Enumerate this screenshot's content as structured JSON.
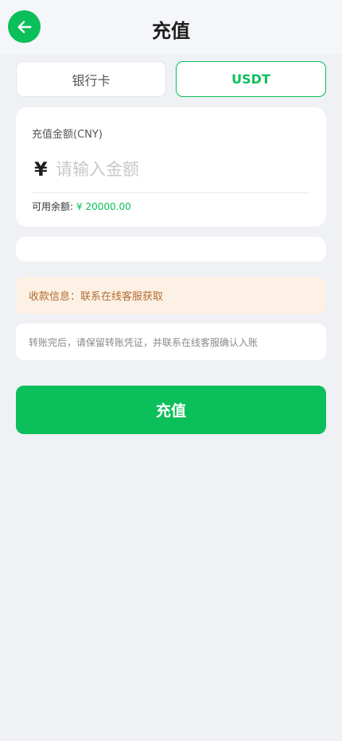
{
  "header": {
    "title": "充值",
    "back_icon": "arrow-left-icon"
  },
  "tabs": [
    {
      "label": "银行卡",
      "selected": false
    },
    {
      "label": "USDT",
      "selected": true
    }
  ],
  "amount": {
    "label": "充值金额(CNY)",
    "currency_symbol": "¥",
    "placeholder": "请输入金额",
    "value": "",
    "balance_label": "可用余额:",
    "balance_value": "¥ 20000.00"
  },
  "payee_info": "收款信息：联系在线客服获取",
  "note": "转账完后，请保留转账凭证，并联系在线客服确认入账",
  "submit_label": "充值",
  "colors": {
    "accent": "#0bbf5a",
    "background": "#eff1f4",
    "warning_bg": "#fdf1e6",
    "warning_text": "#b26a2e"
  }
}
